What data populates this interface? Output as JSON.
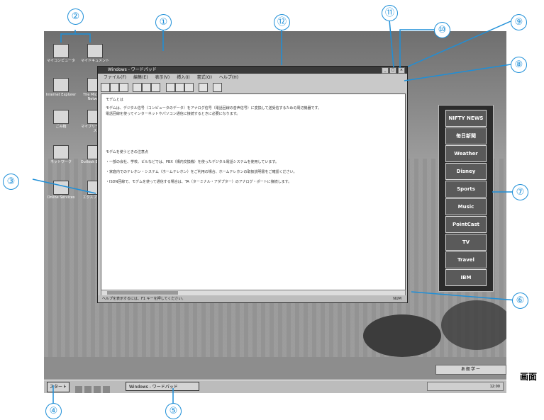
{
  "desktop_icons": [
    {
      "label": "マイコンピュータ"
    },
    {
      "label": "マイドキュメント"
    },
    {
      "label": "Internet Explorer"
    },
    {
      "label": "The Microsoft Network"
    },
    {
      "label": "ごみ箱"
    },
    {
      "label": "マイブリーフケース"
    },
    {
      "label": "ネットワーク"
    },
    {
      "label": "Outlook Express"
    },
    {
      "label": "Online Services"
    },
    {
      "label": "エクスプローラ"
    }
  ],
  "window": {
    "title": "Windows - ワードパッド",
    "menu": [
      "ファイル(F)",
      "編集(E)",
      "表示(V)",
      "挿入(I)",
      "書式(O)",
      "ヘルプ(H)"
    ],
    "minimize": "_",
    "maximize": "□",
    "close": "×",
    "document_lines": [
      "モデムとは",
      "モデムは、デジタル信号（コンピュータのデータ）をアナログ信号（電話回線の音声信号）に変換して送受信するための周辺機器です。",
      "電話回線を使ってインターネットやパソコン通信に接続するときに必要になります。",
      "",
      "モデムを使うときの注意点",
      "・一部の会社、学校、ビルなどでは、PBX（構内交換機）を使ったデジタル電話システムを使用しています。",
      "・家庭内でのテレホン・システム（ホームテレホン）をご利用の場合、ホームテレホンの取扱説明書をご確認ください。",
      "・ISDN回線で、モデムを使って通信する場合は、TA（ターミナル・アダプター）のアナログ・ポートに接続します。"
    ],
    "status": "ヘルプを表示するには、F1 キーを押してください。",
    "status_right": "NUM"
  },
  "channel_bar": [
    "NIFTY NEWS",
    "毎日新聞",
    "Weather",
    "Disney",
    "Sports",
    "Music",
    "PointCast",
    "TV",
    "Travel",
    "IBM"
  ],
  "taskbar": {
    "start": "スタート",
    "task": "Windows - ワードパッド",
    "clock": "12:00"
  },
  "ime_bar": "あ般学ー",
  "callouts": [
    "①",
    "②",
    "③",
    "④",
    "⑤",
    "⑥",
    "⑦",
    "⑧",
    "⑨",
    "⑩",
    "⑪",
    "⑫"
  ],
  "caption": "画面",
  "colors": {
    "callout": "#1e8fd8"
  }
}
